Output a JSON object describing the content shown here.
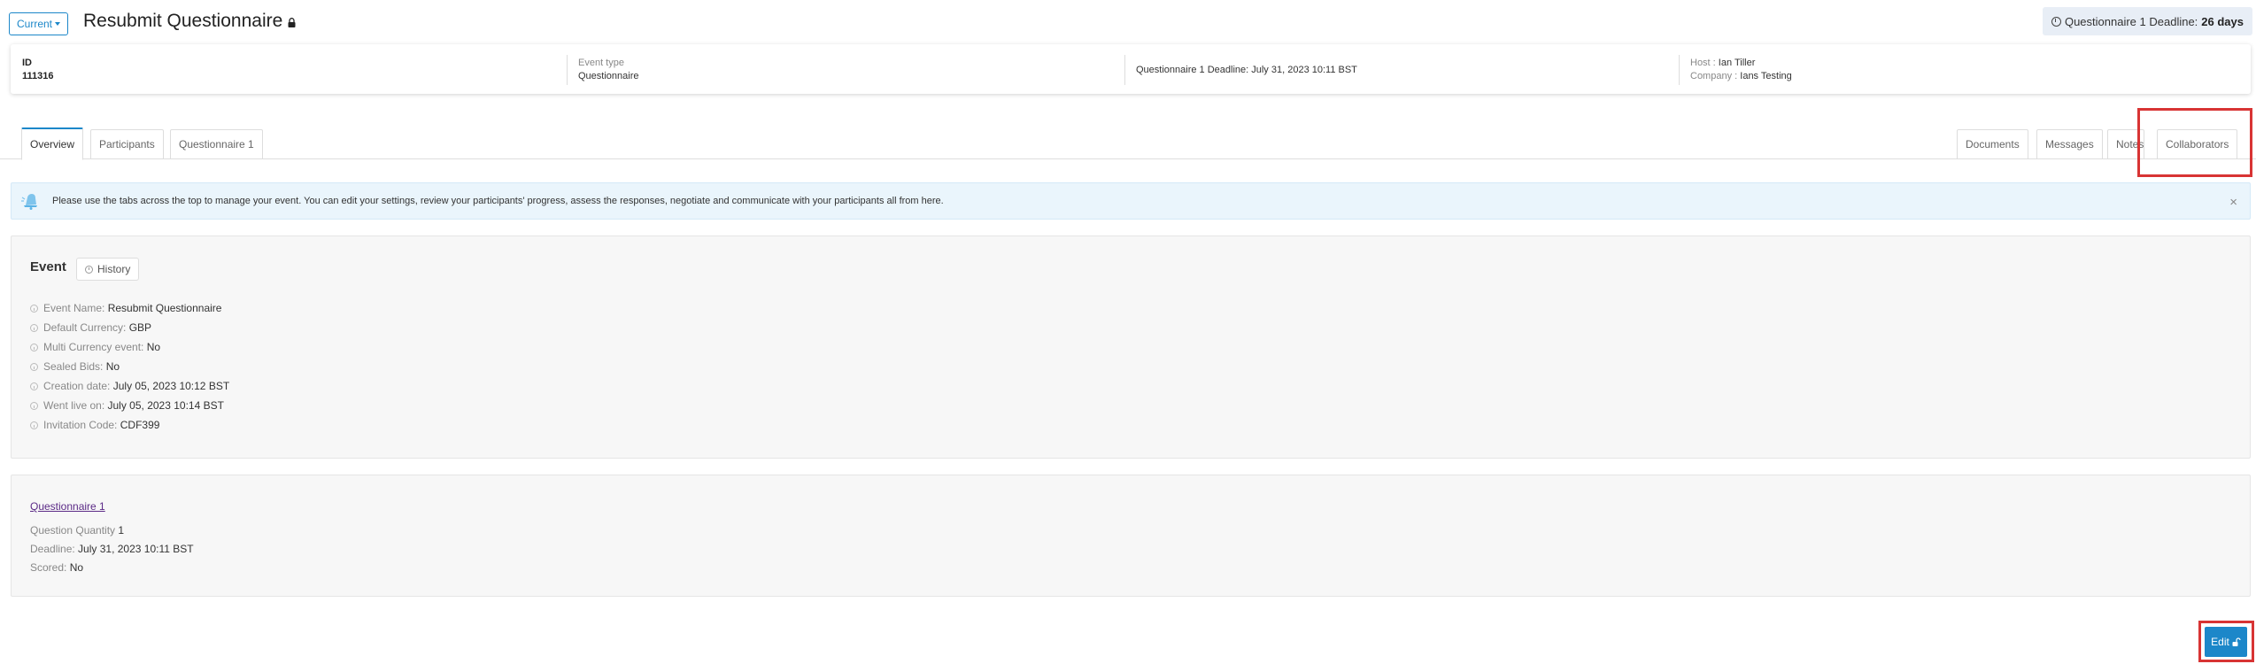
{
  "header": {
    "version_label": "Current",
    "title": "Resubmit Questionnaire",
    "deadline_prefix": "Questionnaire 1 Deadline:",
    "deadline_value": "26 days"
  },
  "summary": {
    "id_label": "ID",
    "id_value": "111316",
    "event_type_label": "Event type",
    "event_type_value": "Questionnaire",
    "deadline_text": "Questionnaire 1 Deadline: July 31, 2023 10:11 BST",
    "host_label": "Host :",
    "host_value": "Ian Tiller",
    "company_label": "Company :",
    "company_value": "Ians Testing"
  },
  "tabs_left": [
    "Overview",
    "Participants",
    "Questionnaire 1"
  ],
  "tabs_right": [
    "Documents",
    "Messages",
    "Notes",
    "Collaborators"
  ],
  "alert": {
    "text": "Please use the tabs across the top to manage your event. You can edit your settings, review your participants' progress, assess the responses, negotiate and communicate with your participants all from here.",
    "close": "×"
  },
  "event": {
    "title": "Event",
    "history_label": "History",
    "rows": [
      {
        "label": "Event Name:",
        "value": "Resubmit Questionnaire"
      },
      {
        "label": "Default Currency:",
        "value": "GBP"
      },
      {
        "label": "Multi Currency event:",
        "value": "No"
      },
      {
        "label": "Sealed Bids:",
        "value": "No"
      },
      {
        "label": "Creation date:",
        "value": "July 05, 2023 10:12 BST"
      },
      {
        "label": "Went live on:",
        "value": "July 05, 2023 10:14 BST"
      },
      {
        "label": "Invitation Code:",
        "value": "CDF399"
      }
    ]
  },
  "questionnaire": {
    "link": "Questionnaire 1",
    "quantity_label": "Question Quantity",
    "quantity_value": "1",
    "deadline_label": "Deadline:",
    "deadline_value": "July 31, 2023 10:11 BST",
    "scored_label": "Scored:",
    "scored_value": "No"
  },
  "edit_label": "Edit",
  "colors": {
    "accent": "#1c87c9",
    "highlight": "#d83434",
    "link": "#5b2a86"
  }
}
